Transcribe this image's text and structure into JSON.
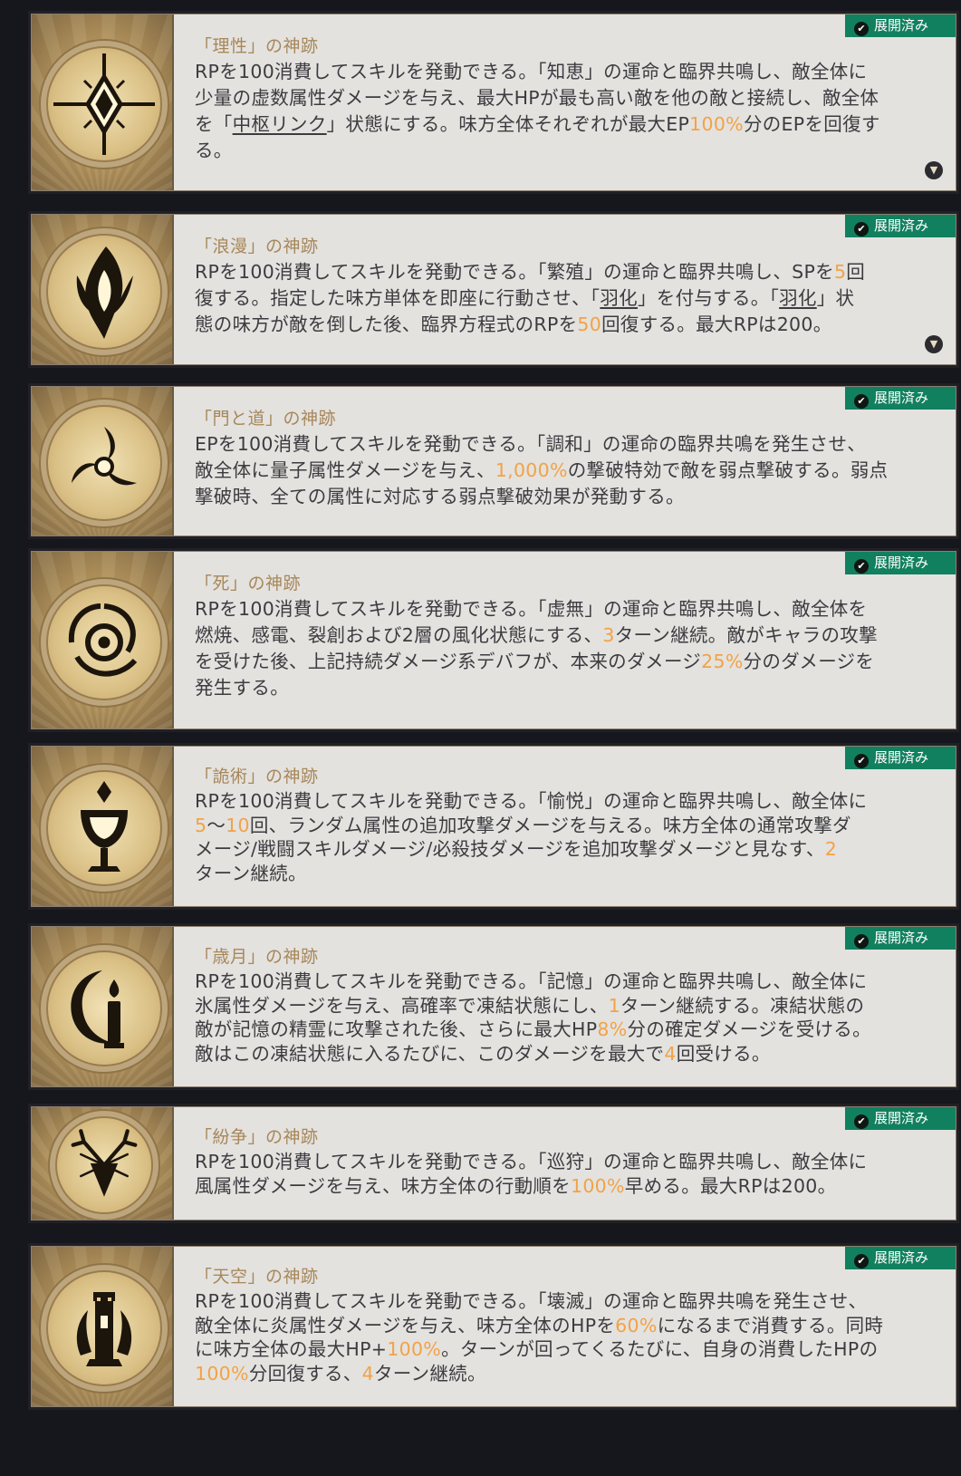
{
  "expanded_label": "展開済み",
  "icons": {
    "badge": "check-icon",
    "expand": "chevron-down-icon"
  },
  "cards": [
    {
      "icon": "crystal-cross-icon",
      "title": "「理性」の神跡",
      "desc": [
        "RPを100消費してスキルを発動できる。「知恵」の運命と臨界共鳴し、敵全体に",
        "少量の虚数属性ダメージを与え、最大HPが最も高い敵を他の敵と接続し、敵全体",
        "を「",
        "中枢リンク",
        "」状態にする。味方全体それぞれが最大EP",
        "100%",
        "分のEPを回復す",
        "る。"
      ]
    },
    {
      "icon": "flame-feather-icon",
      "title": "「浪漫」の神跡",
      "desc": [
        "RPを100消費してスキルを発動できる。「繁殖」の運命と臨界共鳴し、SPを",
        "5",
        "回",
        "復する。指定した味方単体を即座に行動させ、「",
        "羽化",
        "」を付与する。「",
        "羽化",
        "」状",
        "態の味方が敵を倒した後、臨界方程式のRPを",
        "50",
        "回復する。最大RPは200。"
      ]
    },
    {
      "icon": "triskelion-icon",
      "title": "「門と道」の神跡",
      "desc": [
        "EPを100消費してスキルを発動できる。「調和」の運命の臨界共鳴を発生させ、",
        "敵全体に量子属性ダメージを与え、",
        "1,000%",
        "の撃破特効で敵を弱点撃破する。弱点",
        "撃破時、全ての属性に対応する弱点撃破効果が発動する。"
      ]
    },
    {
      "icon": "vortex-eye-icon",
      "title": "「死」の神跡",
      "desc": [
        "RPを100消費してスキルを発動できる。「虚無」の運命と臨界共鳴し、敵全体を",
        "燃焼、感電、裂創および2層の風化状態にする、",
        "3",
        "ターン継続。敵がキャラの攻撃",
        "を受けた後、上記持続ダメージ系デバフが、本来のダメージ",
        "25%",
        "分のダメージを",
        "発生する。"
      ]
    },
    {
      "icon": "chalice-icon",
      "title": "「詭術」の神跡",
      "desc": [
        "RPを100消費してスキルを発動できる。「愉悦」の運命と臨界共鳴し、敵全体に",
        "5",
        "～",
        "10",
        "回、ランダム属性の追加攻撃ダメージを与える。味方全体の通常攻撃ダ",
        "メージ/戦闘スキルダメージ/必殺技ダメージを追加攻撃ダメージと見なす、",
        "2",
        "ターン継続。"
      ]
    },
    {
      "icon": "moon-candle-icon",
      "title": "「歳月」の神跡",
      "desc": [
        "RPを100消費してスキルを発動できる。「記憶」の運命と臨界共鳴し、敵全体に",
        "氷属性ダメージを与え、高確率で凍結状態にし、",
        "1",
        "ターン継続する。凍結状態の",
        "敵が記憶の精霊に攻撃された後、さらに最大HP",
        "8%",
        "分の確定ダメージを受ける。",
        "敵はこの凍結状態に入るたびに、このダメージを最大で",
        "4",
        "回受ける。"
      ]
    },
    {
      "icon": "antlered-beast-icon",
      "title": "「紛争」の神跡",
      "desc": [
        "RPを100消費してスキルを発動できる。「巡狩」の運命と臨界共鳴し、敵全体に",
        "風属性ダメージを与え、味方全体の行動順を",
        "100%",
        "早める。最大RPは200。"
      ]
    },
    {
      "icon": "flaming-tower-icon",
      "title": "「天空」の神跡",
      "desc": [
        "RPを100消費してスキルを発動できる。「壊滅」の運命と臨界共鳴を発生させ、",
        "敵全体に炎属性ダメージを与え、味方全体のHPを",
        "60%",
        "になるまで消費する。同時",
        "に味方全体の最大HP+",
        "100%",
        "。ターンが回ってくるたびに、自身の消費したHPの",
        "100%",
        "分回復する、",
        "4",
        "ターン継続。"
      ]
    }
  ]
}
